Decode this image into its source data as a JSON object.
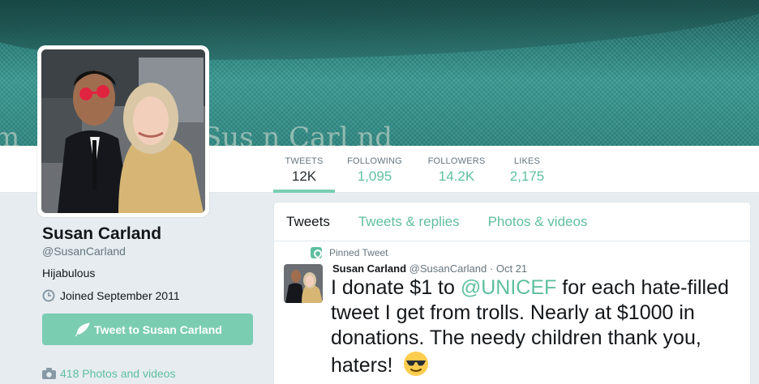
{
  "colors": {
    "accent": "#7bcdb2",
    "link": "#5fbfa0",
    "background": "#e6ecf0"
  },
  "banner": {
    "text_left": "m",
    "text_right": "Sus n Carl nd"
  },
  "stats": [
    {
      "label": "TWEETS",
      "value": "12K"
    },
    {
      "label": "FOLLOWING",
      "value": "1,095"
    },
    {
      "label": "FOLLOWERS",
      "value": "14.2K"
    },
    {
      "label": "LIKES",
      "value": "2,175"
    }
  ],
  "profile": {
    "name": "Susan Carland",
    "handle": "@SusanCarland",
    "bio": "Hijabulous",
    "joined": "Joined September 2011",
    "tweet_to_button": "Tweet to Susan Carland",
    "photos_link": "418 Photos and videos",
    "icons": {
      "joined": "calendar-clock-icon",
      "button": "feather-icon",
      "photos": "camera-icon"
    }
  },
  "timeline": {
    "tabs": [
      "Tweets",
      "Tweets & replies",
      "Photos & videos"
    ],
    "tweet": {
      "pinned_label": "Pinned Tweet",
      "author_name": "Susan Carland",
      "author_handle": "@SusanCarland",
      "separator": "·",
      "date": "Oct 21",
      "text_before": "I donate $1 to ",
      "mention": "@UNICEF",
      "text_after": " for each hate-filled tweet I get from trolls. Nearly at $1000 in donations. The needy children thank you, haters!",
      "emoji": "sunglasses-emoji"
    }
  }
}
